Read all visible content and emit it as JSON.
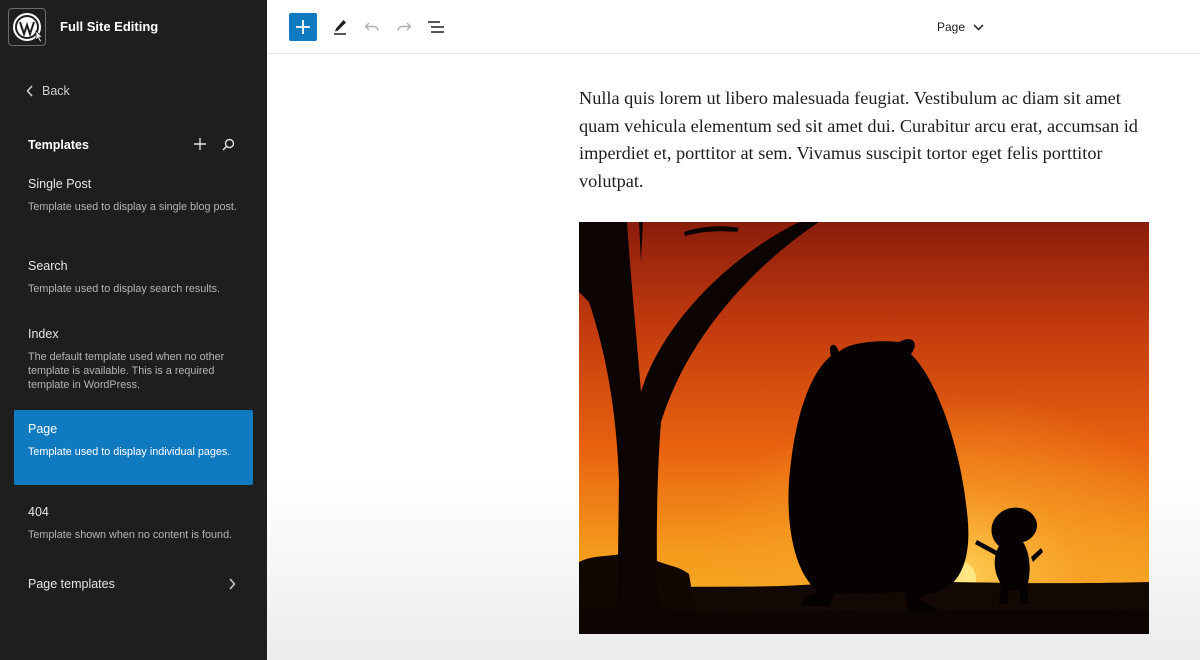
{
  "sidebar": {
    "site_title": "Full Site Editing",
    "back_label": "Back",
    "section_title": "Templates",
    "templates": [
      {
        "name": "Single Post",
        "description": "Template used to display a single blog post."
      },
      {
        "name": "Search",
        "description": "Template used to display search results."
      },
      {
        "name": "Index",
        "description": "The default template used when no other template is available. This is a required template in WordPress."
      },
      {
        "name": "Page",
        "description": "Template used to display individual pages.",
        "active": true
      },
      {
        "name": "404",
        "description": "Template shown when no content is found."
      }
    ],
    "page_templates_label": "Page templates"
  },
  "toolbar": {
    "document_title": "Page"
  },
  "content": {
    "paragraph": "Nulla quis lorem ut libero malesuada feugiat. Vestibulum ac diam sit amet quam vehicula elementum sed sit amet dui. Curabitur arcu erat, accumsan id imperdiet et, porttitor at sem. Vivamus suscipit tortor eget felis porttitor volutpat."
  },
  "colors": {
    "sidebar_bg": "#1e1e1e",
    "accent": "#0f7ac0"
  },
  "icons": [
    "wordpress-logo-icon",
    "chevron-left-icon",
    "plus-icon",
    "search-icon",
    "chevron-right-icon",
    "pencil-icon",
    "undo-icon",
    "redo-icon",
    "list-view-icon",
    "chevron-down-icon"
  ]
}
